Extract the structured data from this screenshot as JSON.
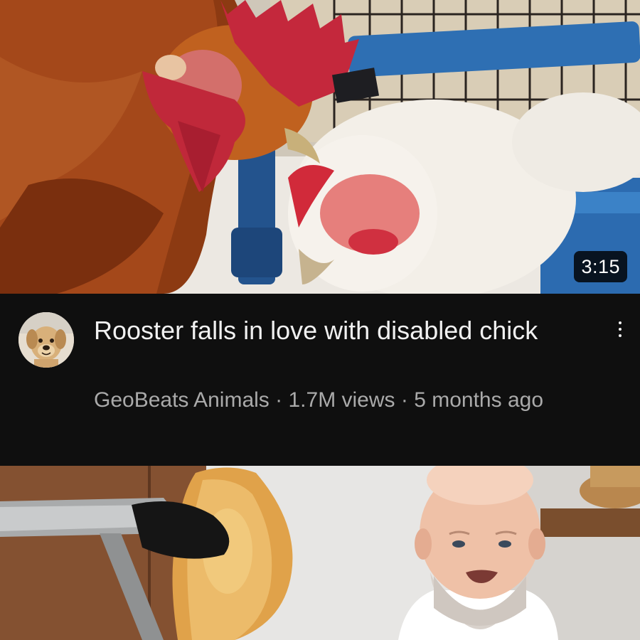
{
  "video": {
    "title": "Rooster falls in love with disabled chick",
    "duration": "3:15",
    "channel": "GeoBeats Animals",
    "views": "1.7M views",
    "age": "5 months ago",
    "separator": "·",
    "thumbnail_subject": "rooster-and-white-hen",
    "avatar_subject": "golden-retriever"
  },
  "next_video": {
    "thumbnail_subject": "chef-with-tongs-holding-chicken-breast"
  },
  "colors": {
    "background": "#0f0f0f",
    "title_text": "#f1f1f1",
    "meta_text": "#aaaaaa",
    "badge_bg": "#000000"
  },
  "icons": {
    "more": "kebab-menu-icon"
  }
}
